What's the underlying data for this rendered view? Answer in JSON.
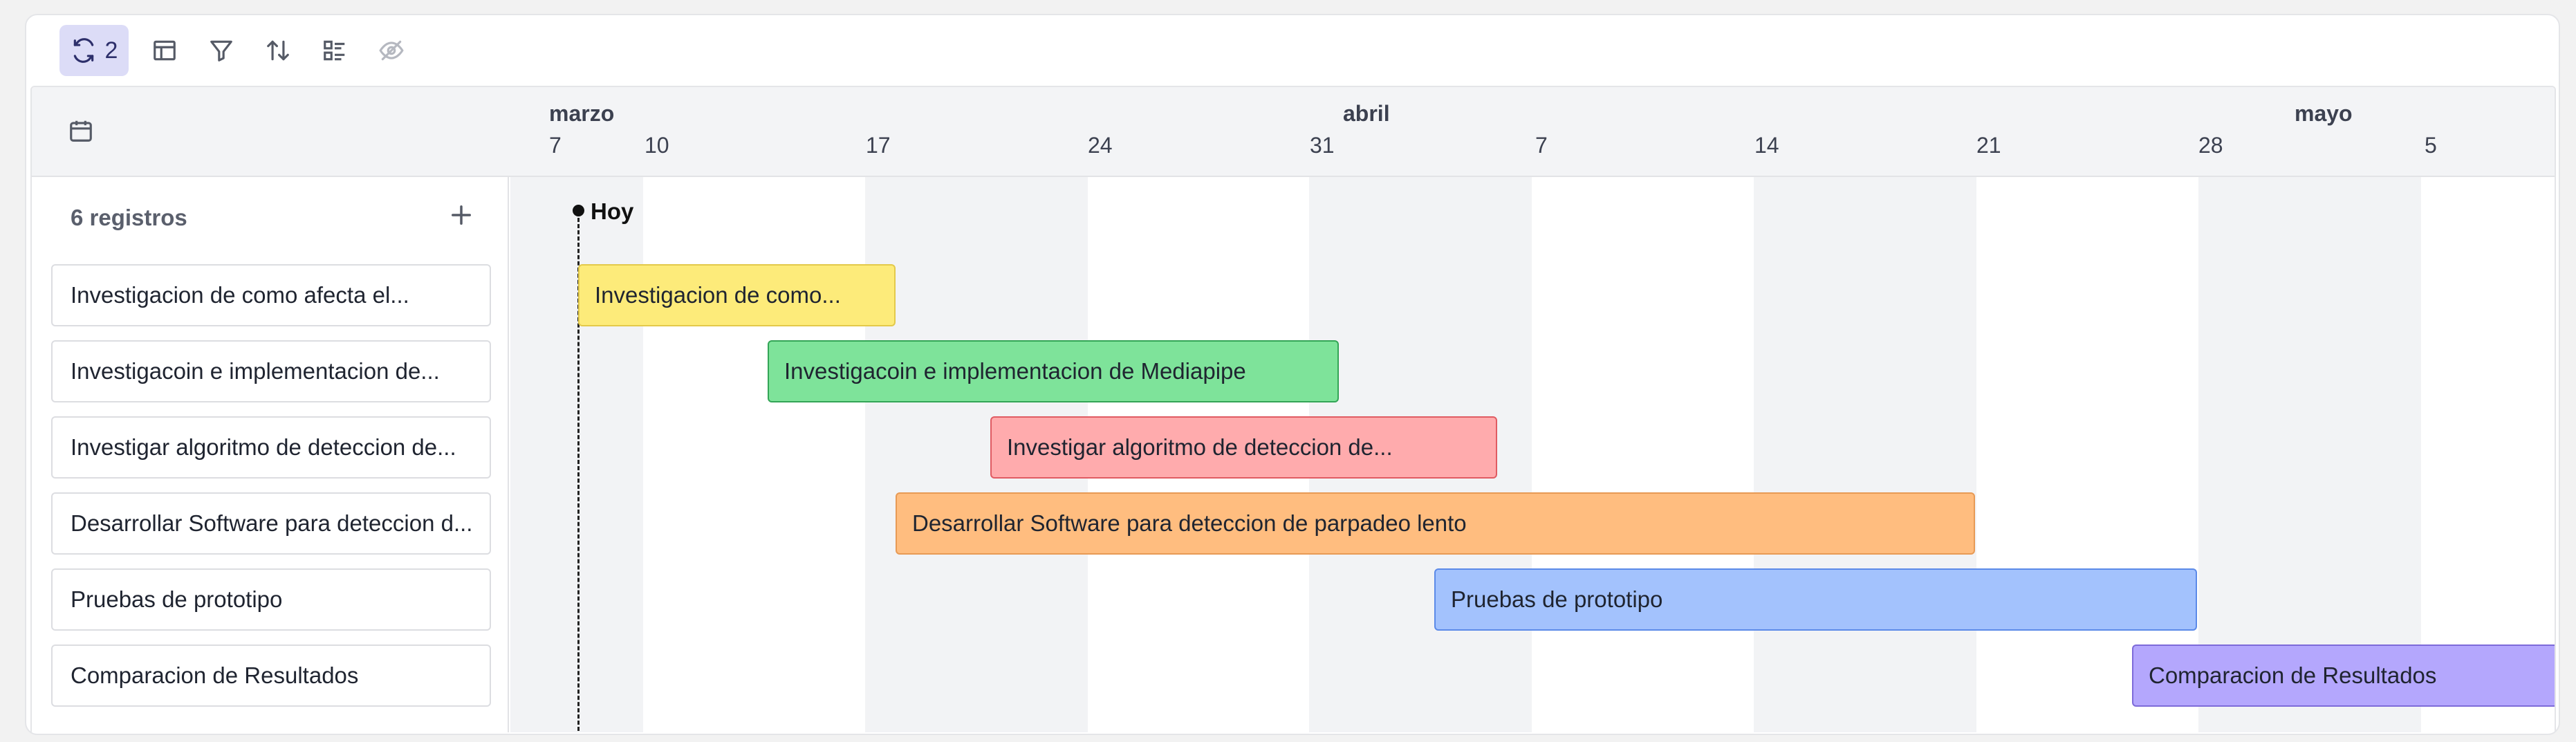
{
  "toolbar": {
    "sync_count": "2",
    "buttons": [
      {
        "icon": "sync-icon",
        "active": true
      },
      {
        "icon": "layout-icon"
      },
      {
        "icon": "filter-icon"
      },
      {
        "icon": "sort-icon"
      },
      {
        "icon": "fields-icon"
      },
      {
        "icon": "hide-icon"
      }
    ]
  },
  "header": {
    "months": [
      "marzo",
      "abril",
      "mayo"
    ],
    "days": [
      "7",
      "10",
      "17",
      "24",
      "31",
      "7",
      "14",
      "21",
      "28",
      "5"
    ]
  },
  "records": {
    "count_label": "6 registros",
    "rows": [
      {
        "label": "Investigacion de como afecta el...",
        "bar_label": "Investigacion de como..."
      },
      {
        "label": "Investigacoin e implementacion de...",
        "bar_label": "Investigacoin e implementacion de Mediapipe"
      },
      {
        "label": "Investigar algoritmo de deteccion de...",
        "bar_label": "Investigar algoritmo de deteccion de..."
      },
      {
        "label": "Desarrollar Software para deteccion d...",
        "bar_label": "Desarrollar Software para deteccion de parpadeo lento"
      },
      {
        "label": "Pruebas de prototipo",
        "bar_label": "Pruebas de prototipo"
      },
      {
        "label": "Comparacion de Resultados",
        "bar_label": "Comparacion de Resultados"
      }
    ]
  },
  "today_label": "Hoy",
  "colors": {
    "accent": "#dcdcf7",
    "bar_yellow": "#fdeb7a",
    "bar_green": "#7ee39a",
    "bar_red": "#ffabad",
    "bar_orange": "#ffbd7f",
    "bar_blue": "#a3c2fd",
    "bar_purple": "#b4a7fd"
  }
}
